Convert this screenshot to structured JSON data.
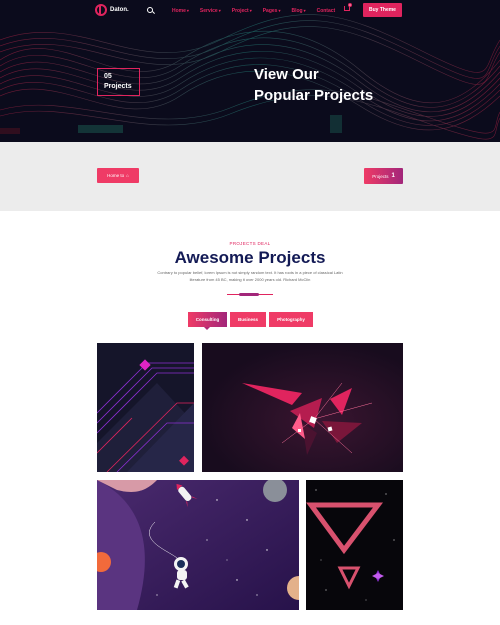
{
  "header": {
    "brand": "Daton.",
    "nav": [
      {
        "label": "Home",
        "has_dropdown": true
      },
      {
        "label": "Service",
        "has_dropdown": true
      },
      {
        "label": "Project",
        "has_dropdown": true
      },
      {
        "label": "Pages",
        "has_dropdown": true
      },
      {
        "label": "Blog",
        "has_dropdown": true
      },
      {
        "label": "Contact",
        "has_dropdown": false
      }
    ],
    "cart_count": "0",
    "cta_label": "Buy Theme"
  },
  "hero": {
    "count_number": "05",
    "count_label": "Projects",
    "title_line1": "View Our",
    "title_line2": "Popular Projects"
  },
  "breadcrumb": {
    "left_label": "Home to",
    "right_label": "Projects",
    "right_number": "1"
  },
  "section": {
    "eyebrow": "PROJECTS DEAL",
    "title": "Awesome Projects",
    "description": "Contrary to popular belief, lorem Ipsum is not simply random text. It has roots in a piece of classical Latin literature from 45 BC, making it over 2000 years old. Richard McClin"
  },
  "filters": [
    {
      "label": "Consulting",
      "active": true
    },
    {
      "label": "Business",
      "active": false
    },
    {
      "label": "Photography",
      "active": false
    }
  ],
  "gallery": [
    {
      "name": "abstract-neon-shapes"
    },
    {
      "name": "shattered-red-crystal"
    },
    {
      "name": "astronaut-rocket-space"
    },
    {
      "name": "neon-triangles"
    }
  ],
  "colors": {
    "accent": "#e0245e",
    "accent_purple": "#a2267a",
    "navy": "#131a55",
    "hero_bg": "#0b0b1c",
    "band_bg": "#ececec"
  },
  "icons": {
    "search": "search-icon",
    "cart": "cart-icon",
    "home": "home-icon",
    "logo": "logo-icon"
  }
}
